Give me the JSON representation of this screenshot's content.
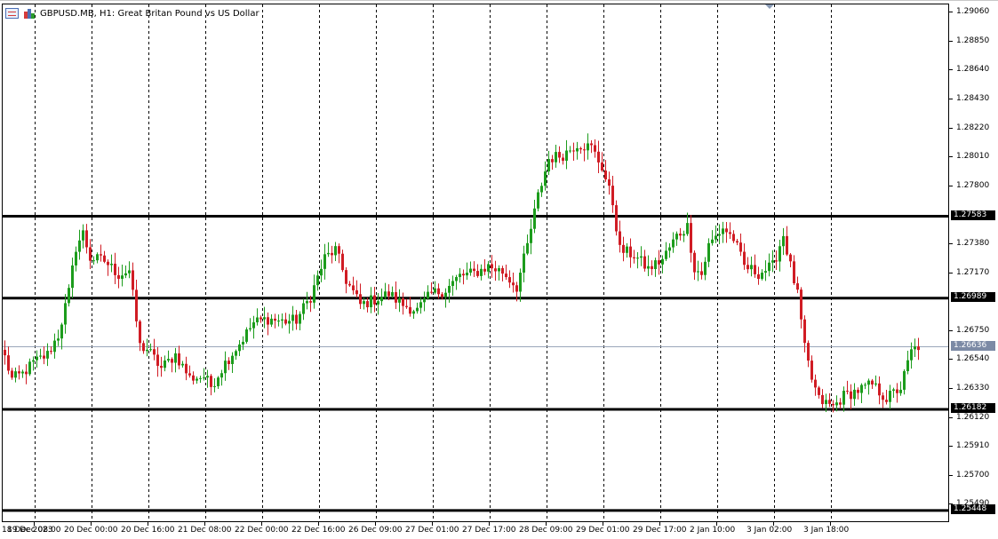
{
  "header": {
    "title": "GBPUSD.MB, H1:  Great Britan Pound vs US Dollar",
    "icons": [
      "quick-list-icon",
      "chart-bars-icon"
    ]
  },
  "colors": {
    "up_candle": "#1c9c1c",
    "down_candle": "#d01c24",
    "grid": "#000000",
    "level_line": "#000000",
    "current_price_line": "#9aa6ba",
    "current_price_tag": "#7c8aa5"
  },
  "price_axis": {
    "labels": [
      "1.29060",
      "1.28850",
      "1.28640",
      "1.28430",
      "1.28220",
      "1.28010",
      "1.27800",
      "1.27380",
      "1.27170",
      "1.26750",
      "1.26540",
      "1.26330",
      "1.26120",
      "1.25910",
      "1.25700",
      "1.25490"
    ]
  },
  "time_axis": {
    "labels": [
      "18 Dec 2023",
      "19 Dec 08:00",
      "20 Dec 00:00",
      "20 Dec 16:00",
      "21 Dec 08:00",
      "22 Dec 00:00",
      "22 Dec 16:00",
      "26 Dec 09:00",
      "27 Dec 01:00",
      "27 Dec 17:00",
      "28 Dec 09:00",
      "29 Dec 01:00",
      "29 Dec 17:00",
      "2 Jan 10:00",
      "3 Jan 02:00",
      "3 Jan 18:00"
    ]
  },
  "chart_data": {
    "type": "candlestick",
    "symbol": "GBPUSD.MB",
    "timeframe": "H1",
    "ylim": [
      1.2537,
      1.2912
    ],
    "grid": "vertical dashed",
    "current_price": "1.26636",
    "horizontal_levels": [
      "1.27583",
      "1.26989",
      "1.26182",
      "1.25448"
    ],
    "x_tick_bar_index": [
      0,
      8,
      24,
      40,
      56,
      72,
      88,
      104,
      120,
      136,
      152,
      168,
      184,
      200,
      216,
      232
    ],
    "close_path": [
      [
        0,
        1.2656
      ],
      [
        2,
        1.264
      ],
      [
        5,
        1.2644
      ],
      [
        8,
        1.2652
      ],
      [
        12,
        1.2658
      ],
      [
        15,
        1.2672
      ],
      [
        18,
        1.2703
      ],
      [
        20,
        1.2736
      ],
      [
        22,
        1.2746
      ],
      [
        24,
        1.2728
      ],
      [
        28,
        1.2726
      ],
      [
        32,
        1.2716
      ],
      [
        35,
        1.2719
      ],
      [
        38,
        1.2664
      ],
      [
        40,
        1.2662
      ],
      [
        44,
        1.2648
      ],
      [
        48,
        1.2658
      ],
      [
        52,
        1.2641
      ],
      [
        56,
        1.2642
      ],
      [
        58,
        1.2635
      ],
      [
        62,
        1.2652
      ],
      [
        66,
        1.2666
      ],
      [
        70,
        1.2681
      ],
      [
        74,
        1.2684
      ],
      [
        78,
        1.2682
      ],
      [
        82,
        1.2683
      ],
      [
        86,
        1.27
      ],
      [
        90,
        1.2728
      ],
      [
        93,
        1.2734
      ],
      [
        96,
        1.2712
      ],
      [
        100,
        1.2694
      ],
      [
        104,
        1.2698
      ],
      [
        108,
        1.2702
      ],
      [
        112,
        1.2694
      ],
      [
        116,
        1.269
      ],
      [
        120,
        1.2702
      ],
      [
        124,
        1.2705
      ],
      [
        128,
        1.2715
      ],
      [
        132,
        1.2717
      ],
      [
        136,
        1.2722
      ],
      [
        140,
        1.2718
      ],
      [
        144,
        1.2707
      ],
      [
        147,
        1.2737
      ],
      [
        150,
        1.2773
      ],
      [
        153,
        1.28
      ],
      [
        157,
        1.2803
      ],
      [
        161,
        1.2811
      ],
      [
        165,
        1.2808
      ],
      [
        168,
        1.2794
      ],
      [
        171,
        1.2768
      ],
      [
        173,
        1.2734
      ],
      [
        177,
        1.273
      ],
      [
        181,
        1.272
      ],
      [
        185,
        1.2727
      ],
      [
        189,
        1.2744
      ],
      [
        192,
        1.2751
      ],
      [
        194,
        1.2721
      ],
      [
        196,
        1.2716
      ],
      [
        198,
        1.2737
      ],
      [
        202,
        1.275
      ],
      [
        205,
        1.2742
      ],
      [
        208,
        1.2722
      ],
      [
        212,
        1.2717
      ],
      [
        216,
        1.2722
      ],
      [
        219,
        1.2745
      ],
      [
        221,
        1.2722
      ],
      [
        223,
        1.2701
      ],
      [
        225,
        1.2662
      ],
      [
        227,
        1.264
      ],
      [
        229,
        1.2625
      ],
      [
        233,
        1.262
      ],
      [
        236,
        1.2628
      ],
      [
        240,
        1.2632
      ],
      [
        244,
        1.2636
      ],
      [
        248,
        1.2626
      ],
      [
        252,
        1.2634
      ],
      [
        255,
        1.266
      ],
      [
        257,
        1.2664
      ]
    ]
  }
}
